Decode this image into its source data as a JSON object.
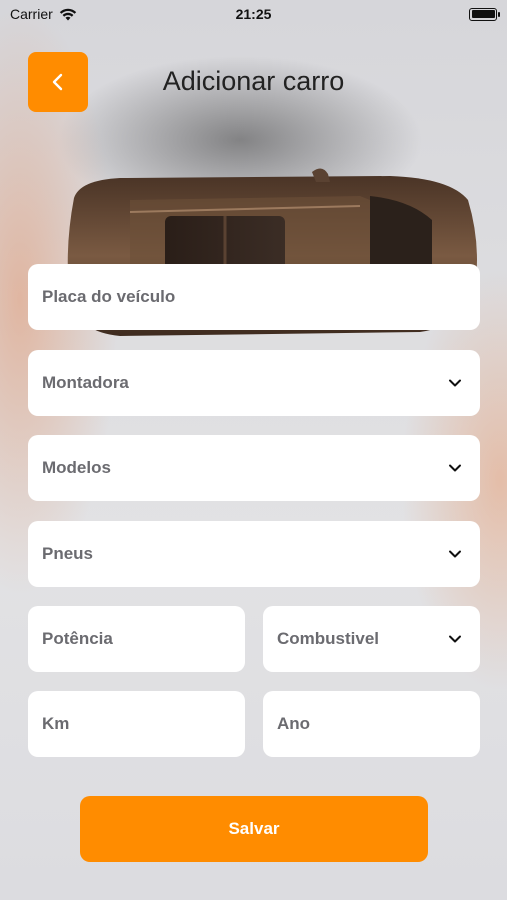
{
  "status": {
    "carrier": "Carrier",
    "time": "21:25"
  },
  "header": {
    "title": "Adicionar carro",
    "back_icon": "chevron-left-icon"
  },
  "form": {
    "plate_placeholder": "Placa do veículo",
    "maker_placeholder": "Montadora",
    "models_placeholder": "Modelos",
    "tires_placeholder": "Pneus",
    "power_placeholder": "Potência",
    "fuel_placeholder": "Combustivel",
    "km_placeholder": "Km",
    "year_placeholder": "Ano"
  },
  "actions": {
    "save_label": "Salvar"
  },
  "colors": {
    "accent": "#ff8c00",
    "field_bg": "#ffffff"
  }
}
